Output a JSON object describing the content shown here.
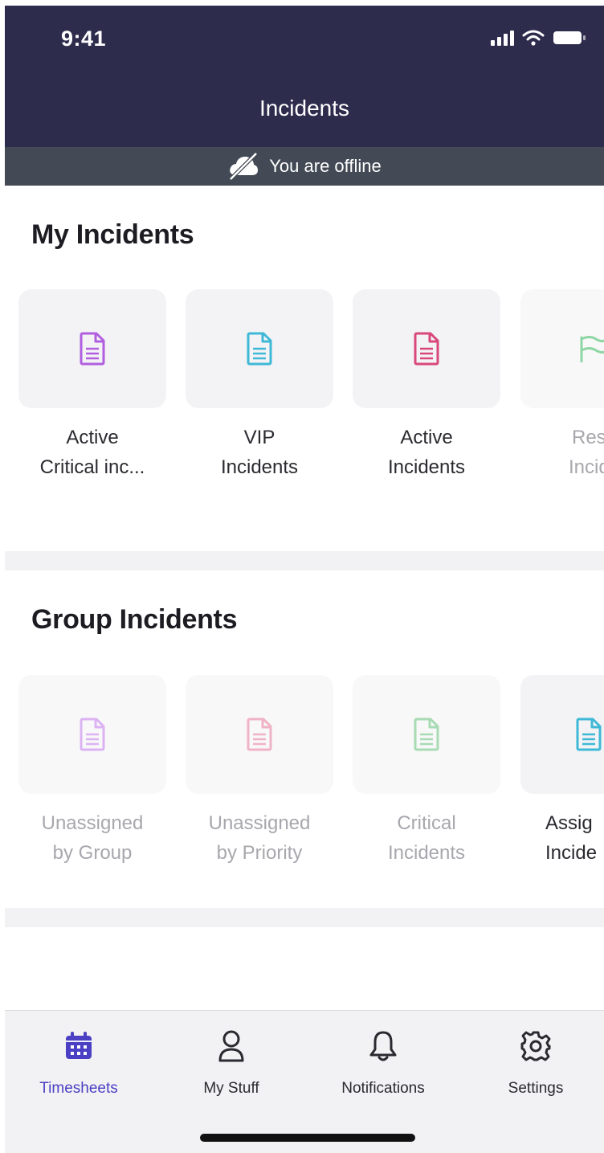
{
  "status_bar": {
    "time": "9:41"
  },
  "header": {
    "title": "Incidents"
  },
  "offline_banner": {
    "text": "You are offline"
  },
  "my_incidents": {
    "title": "My Incidents",
    "tiles": [
      {
        "line1": "Active",
        "line2": "Critical inc...",
        "icon": "document-icon",
        "color": "#b15fe0"
      },
      {
        "line1": "VIP",
        "line2": "Incidents",
        "icon": "document-icon",
        "color": "#3fb8d6"
      },
      {
        "line1": "Active",
        "line2": "Incidents",
        "icon": "document-icon",
        "color": "#d9487a"
      },
      {
        "line1": "Reso",
        "line2": "Incide",
        "icon": "flag-icon",
        "color": "#8ed6a3"
      }
    ]
  },
  "group_incidents": {
    "title": "Group Incidents",
    "tiles": [
      {
        "line1": "Unassigned",
        "line2": "by Group",
        "icon": "document-icon",
        "color": "#dcb3f2"
      },
      {
        "line1": "Unassigned",
        "line2": "by Priority",
        "icon": "document-icon",
        "color": "#f0b3c6"
      },
      {
        "line1": "Critical",
        "line2": "Incidents",
        "icon": "document-icon",
        "color": "#a8dbb4"
      },
      {
        "line1": "Assig",
        "line2": "Incide",
        "icon": "document-icon",
        "color": "#3fb8d6"
      }
    ]
  },
  "tab_bar": {
    "tabs": [
      {
        "label": "Timesheets",
        "icon": "calendar-icon",
        "active": true
      },
      {
        "label": "My Stuff",
        "icon": "person-icon",
        "active": false
      },
      {
        "label": "Notifications",
        "icon": "bell-icon",
        "active": false
      },
      {
        "label": "Settings",
        "icon": "gear-icon",
        "active": false
      }
    ],
    "active_color": "#4b3fc4"
  },
  "colors": {
    "header_bg": "#2e2c4d",
    "offline_bg": "#434a55"
  }
}
